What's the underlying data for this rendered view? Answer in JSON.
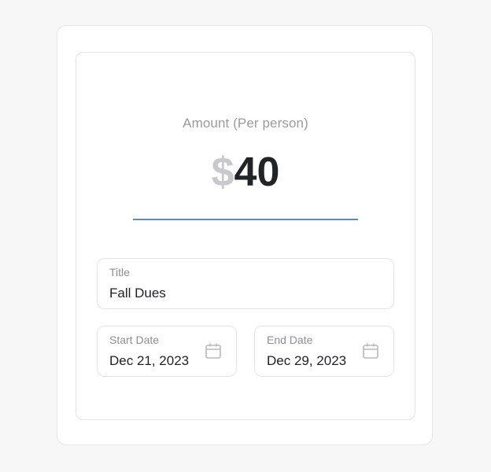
{
  "amount": {
    "label": "Amount (Per person)",
    "currency_symbol": "$",
    "value": "40"
  },
  "title_field": {
    "label": "Title",
    "value": "Fall Dues"
  },
  "start_date": {
    "label": "Start Date",
    "value": "Dec 21, 2023",
    "icon": "calendar-icon"
  },
  "end_date": {
    "label": "End Date",
    "value": "Dec 29, 2023",
    "icon": "calendar-icon"
  },
  "colors": {
    "accent_underline": "#5b87d6",
    "currency_symbol": "#c9c9cd",
    "amount_text": "#222326",
    "label_text": "#8e8e94",
    "border": "#e3e3e6"
  }
}
